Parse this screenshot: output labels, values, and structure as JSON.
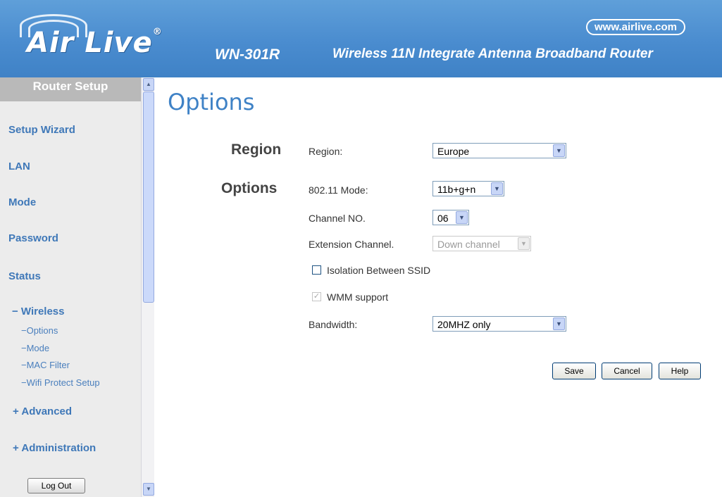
{
  "header": {
    "logo": "Air Live",
    "logo_mark": "®",
    "url": "www.airlive.com",
    "model": "WN-301R",
    "tagline": "Wireless 11N Integrate Antenna Broadband Router"
  },
  "sidebar": {
    "title": "Router Setup",
    "items": [
      {
        "label": "Setup Wizard"
      },
      {
        "label": "LAN"
      },
      {
        "label": "Mode"
      },
      {
        "label": "Password"
      },
      {
        "label": "Status"
      },
      {
        "label": "− Wireless"
      },
      {
        "label": "−Options"
      },
      {
        "label": "−Mode"
      },
      {
        "label": "−MAC Filter"
      },
      {
        "label": "−Wifi Protect Setup"
      },
      {
        "label": "+ Advanced"
      },
      {
        "label": "+ Administration"
      }
    ],
    "logout_label": "Log Out"
  },
  "main": {
    "title": "Options",
    "region_section": "Region",
    "region_label": "Region:",
    "region_value": "Europe",
    "options_section": "Options",
    "mode_label": "802.11 Mode:",
    "mode_value": "11b+g+n",
    "channel_label": "Channel NO.",
    "channel_value": "06",
    "ext_label": "Extension Channel.",
    "ext_value": "Down channel",
    "isolation_label": "Isolation Between SSID",
    "isolation_checked": false,
    "wmm_label": "WMM support",
    "wmm_checked": true,
    "bandwidth_label": "Bandwidth:",
    "bandwidth_value": "20MHZ only",
    "save_label": "Save",
    "cancel_label": "Cancel",
    "help_label": "Help"
  }
}
